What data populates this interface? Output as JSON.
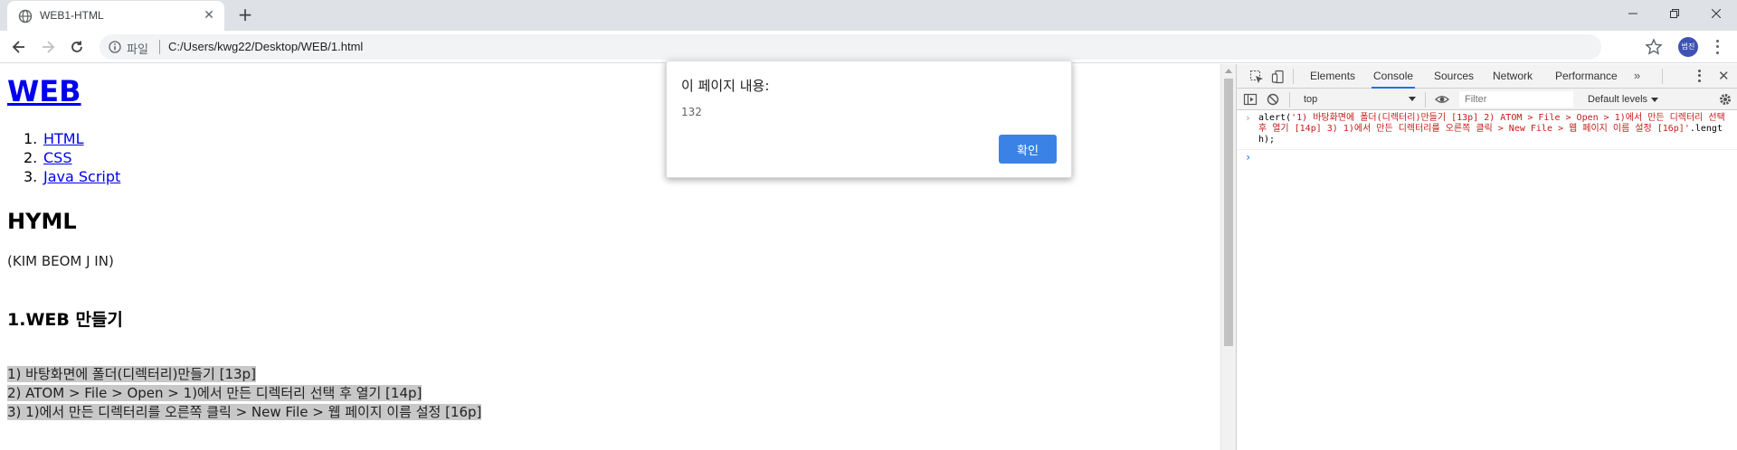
{
  "browser": {
    "tab_title": "WEB1-HTML",
    "new_tab_symbol": "+",
    "scheme_label": "파일",
    "url": "C:/Users/kwg22/Desktop/WEB/1.html",
    "profile_initials": "범진"
  },
  "page": {
    "heading": "WEB",
    "nav_list": [
      {
        "num": "1.",
        "label": "HTML"
      },
      {
        "num": "2.",
        "label": "CSS"
      },
      {
        "num": "3.",
        "label": "Java Script"
      }
    ],
    "subheading": "HYML",
    "author": "(KIM BEOM J IN)",
    "section_title": "1.WEB 만들기",
    "steps": [
      "1) 바탕화면에 폴더(디렉터리)만들기 [13p]",
      "2) ATOM > File > Open > 1)에서 만든 디렉터리 선택 후 열기 [14p]",
      "3) 1)에서 만든 디렉터리를 오른쪽 클릭 > New File > 웹 페이지 이름 설정 [16p]"
    ]
  },
  "dialog": {
    "title": "이 페이지 내용:",
    "message": "132",
    "ok_label": "확인"
  },
  "devtools": {
    "tabs": [
      "Elements",
      "Console",
      "Sources",
      "Network",
      "Performance"
    ],
    "active_tab": "Console",
    "more_symbol": "»",
    "context": "top",
    "filter_placeholder": "Filter",
    "levels_label": "Default levels",
    "log": {
      "prefix": "alert(",
      "string": "'1) 바탕화면에 폴더(디렉터리)만들기 [13p] 2) ATOM > File > Open > 1)에서 만든 디렉터리 선택 후 열기 [14p] 3) 1)에서 만든 디렉터리를 오른쪽 클릭 > New File > 웹 페이지 이름 설정 [16p]'",
      "suffix": ".length);"
    },
    "prompt_symbol": "›",
    "log_chevron": "›"
  },
  "colors": {
    "link": "#0000ee",
    "highlight": "#c8c8c8",
    "dialog_button": "#3b82e6",
    "console_string": "#c41a16",
    "active_tab_underline": "#1a73e8"
  }
}
